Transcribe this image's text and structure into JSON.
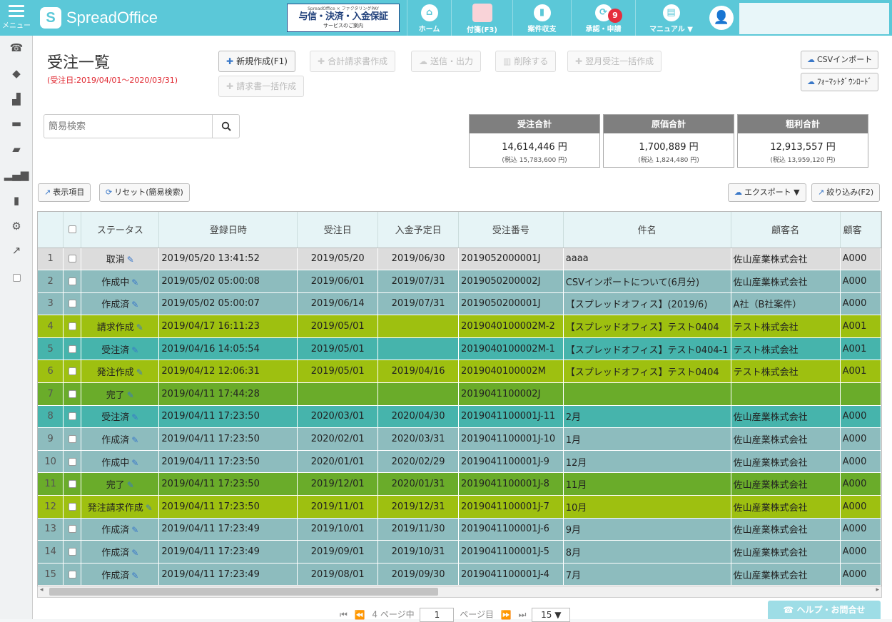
{
  "topbar": {
    "menu_label": "メニュー",
    "logo_text": "SpreadOffice",
    "banner": {
      "top": "SpreadOffice × ファクタリングPAY",
      "main": "与信・決済・入金保証",
      "sub": "サービスのご案内"
    },
    "nav": [
      {
        "label": "ホーム",
        "icon": "home-icon"
      },
      {
        "label": "付箋(F3)",
        "icon": "sticky-note-icon"
      },
      {
        "label": "案件収支",
        "icon": "bar-chart-icon"
      },
      {
        "label": "承認・申請",
        "icon": "approval-icon",
        "badge": "9"
      },
      {
        "label": "マニュアル ▼",
        "icon": "book-icon"
      }
    ]
  },
  "sidebar": [
    "phone-icon",
    "tag-icon",
    "chart-icon",
    "card-icon",
    "folder-icon",
    "signal-icon",
    "file-icon",
    "gear-icon",
    "external-link-icon",
    "checkbox-icon"
  ],
  "page": {
    "title": "受注一覧",
    "date_range": "(受注日:2019/04/01～2020/03/31)"
  },
  "toolbar": {
    "new": "新規作成(F1)",
    "total_invoice": "合計請求書作成",
    "send_output": "送信・出力",
    "delete": "削除する",
    "next_month_bulk": "翌月受注一括作成",
    "bulk_invoice": "請求書一括作成",
    "csv_import": "CSVインポート",
    "format_download": "ﾌｫｰﾏｯﾄﾀﾞｳﾝﾛｰﾄﾞ"
  },
  "search": {
    "placeholder": "簡易検索"
  },
  "summary": [
    {
      "title": "受注合計",
      "value": "14,614,446 円",
      "sub": "(税込 15,783,600 円)"
    },
    {
      "title": "原価合計",
      "value": "1,700,889 円",
      "sub": "(税込 1,824,480 円)"
    },
    {
      "title": "粗利合計",
      "value": "12,913,557 円",
      "sub": "(税込 13,959,120 円)"
    }
  ],
  "actions": {
    "display_items": "表示項目",
    "reset": "リセット(簡易検索)",
    "export": "エクスポート ▼",
    "filter": "絞り込み(F2)"
  },
  "table": {
    "columns": [
      "ステータス",
      "登録日時",
      "受注日",
      "入金予定日",
      "受注番号",
      "件名",
      "顧客名",
      "顧客"
    ],
    "rows": [
      {
        "n": "1",
        "status": "取消",
        "reg": "2019/05/20 13:41:52",
        "order": "2019/05/20",
        "pay": "2019/06/30",
        "no": "2019052000001J",
        "subject": "aaaa",
        "customer": "佐山産業株式会社",
        "code": "A000",
        "cls": "s-torikeshi"
      },
      {
        "n": "2",
        "status": "作成中",
        "reg": "2019/05/02 05:00:08",
        "order": "2019/06/01",
        "pay": "2019/07/31",
        "no": "2019050200002J",
        "subject": "CSVインポートについて(6月分)",
        "customer": "佐山産業株式会社",
        "code": "A000",
        "cls": "s-sakusei"
      },
      {
        "n": "3",
        "status": "作成済",
        "reg": "2019/05/02 05:00:07",
        "order": "2019/06/14",
        "pay": "2019/07/31",
        "no": "2019050200001J",
        "subject": "【スプレッドオフィス】(2019/6)",
        "customer": "A社（B社案件）",
        "code": "A000",
        "cls": "s-sakusei"
      },
      {
        "n": "4",
        "status": "請求作成",
        "reg": "2019/04/17 16:11:23",
        "order": "2019/05/01",
        "pay": "",
        "no": "2019040100002M-2",
        "subject": "【スプレッドオフィス】テスト0404",
        "customer": "テスト株式会社",
        "code": "A001",
        "cls": "s-seikyu"
      },
      {
        "n": "5",
        "status": "受注済",
        "reg": "2019/04/16 14:05:54",
        "order": "2019/05/01",
        "pay": "",
        "no": "2019040100002M-1",
        "subject": "【スプレッドオフィス】テスト0404-1",
        "customer": "テスト株式会社",
        "code": "A001",
        "cls": "s-juchuzumi"
      },
      {
        "n": "6",
        "status": "発注作成",
        "reg": "2019/04/12 12:06:31",
        "order": "2019/05/01",
        "pay": "2019/04/16",
        "no": "2019040100002M",
        "subject": "【スプレッドオフィス】テスト0404",
        "customer": "テスト株式会社",
        "code": "A001",
        "cls": "s-seikyu"
      },
      {
        "n": "7",
        "status": "完了",
        "reg": "2019/04/11 17:44:28",
        "order": "",
        "pay": "",
        "no": "2019041100002J",
        "subject": "",
        "customer": "",
        "code": "",
        "cls": "s-kanryo"
      },
      {
        "n": "8",
        "status": "受注済",
        "reg": "2019/04/11 17:23:50",
        "order": "2020/03/01",
        "pay": "2020/04/30",
        "no": "2019041100001J-11",
        "subject": "2月",
        "customer": "佐山産業株式会社",
        "code": "A000",
        "cls": "s-juchuzumi"
      },
      {
        "n": "9",
        "status": "作成済",
        "reg": "2019/04/11 17:23:50",
        "order": "2020/02/01",
        "pay": "2020/03/31",
        "no": "2019041100001J-10",
        "subject": "1月",
        "customer": "佐山産業株式会社",
        "code": "A000",
        "cls": "s-sakusei"
      },
      {
        "n": "10",
        "status": "作成中",
        "reg": "2019/04/11 17:23:50",
        "order": "2020/01/01",
        "pay": "2020/02/29",
        "no": "2019041100001J-9",
        "subject": "12月",
        "customer": "佐山産業株式会社",
        "code": "A000",
        "cls": "s-sakusei"
      },
      {
        "n": "11",
        "status": "完了",
        "reg": "2019/04/11 17:23:50",
        "order": "2019/12/01",
        "pay": "2020/01/31",
        "no": "2019041100001J-8",
        "subject": "11月",
        "customer": "佐山産業株式会社",
        "code": "A000",
        "cls": "s-kanryo"
      },
      {
        "n": "12",
        "status": "発注請求作成",
        "reg": "2019/04/11 17:23:50",
        "order": "2019/11/01",
        "pay": "2019/12/31",
        "no": "2019041100001J-7",
        "subject": "10月",
        "customer": "佐山産業株式会社",
        "code": "A000",
        "cls": "s-seikyu"
      },
      {
        "n": "13",
        "status": "作成済",
        "reg": "2019/04/11 17:23:49",
        "order": "2019/10/01",
        "pay": "2019/11/30",
        "no": "2019041100001J-6",
        "subject": "9月",
        "customer": "佐山産業株式会社",
        "code": "A000",
        "cls": "s-sakusei"
      },
      {
        "n": "14",
        "status": "作成済",
        "reg": "2019/04/11 17:23:49",
        "order": "2019/09/01",
        "pay": "2019/10/31",
        "no": "2019041100001J-5",
        "subject": "8月",
        "customer": "佐山産業株式会社",
        "code": "A000",
        "cls": "s-sakusei"
      },
      {
        "n": "15",
        "status": "作成済",
        "reg": "2019/04/11 17:23:49",
        "order": "2019/08/01",
        "pay": "2019/09/30",
        "no": "2019041100001J-4",
        "subject": "7月",
        "customer": "佐山産業株式会社",
        "code": "A000",
        "cls": "s-sakusei"
      }
    ]
  },
  "pager": {
    "prefix": "4 ページ中",
    "current": "1",
    "suffix": "ページ目",
    "per_page": "15 ▼"
  },
  "help": "ヘルプ・お問合せ"
}
